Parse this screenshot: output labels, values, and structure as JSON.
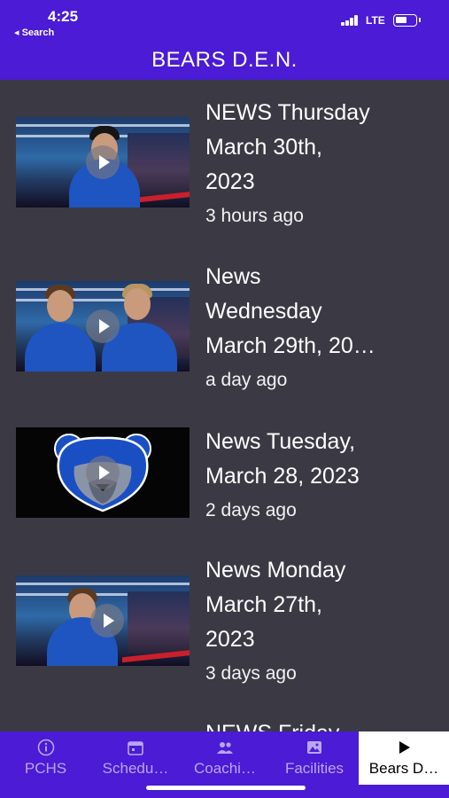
{
  "status": {
    "time": "4:25",
    "back_label": "◂ Search",
    "network": "LTE"
  },
  "header": {
    "title": "BEARS D.E.N."
  },
  "videos": [
    {
      "title": "NEWS Thursday March 30th, 2023",
      "title_lines": [
        "NEWS Thursday",
        "March 30th,",
        "2023"
      ],
      "age": "3 hours ago",
      "thumbnail": "news-desk-anchor"
    },
    {
      "title": "News Wednesday March 29th, 20…",
      "title_lines": [
        "News",
        "Wednesday",
        "March 29th, 20…"
      ],
      "age": "a day ago",
      "thumbnail": "news-desk-two-anchors"
    },
    {
      "title": "News Tuesday, March 28, 2023",
      "title_lines": [
        "News Tuesday,",
        "March 28, 2023"
      ],
      "age": "2 days ago",
      "thumbnail": "bear-logo"
    },
    {
      "title": "News Monday March 27th, 2023",
      "title_lines": [
        "News Monday",
        "March 27th,",
        "2023"
      ],
      "age": "3 days ago",
      "thumbnail": "news-desk-anchor"
    },
    {
      "title": "NEWS Friday",
      "title_lines": [
        "NEWS Friday"
      ],
      "age": "",
      "thumbnail": ""
    }
  ],
  "tabs": [
    {
      "label": "PCHS",
      "icon": "info-icon"
    },
    {
      "label": "Schedu…",
      "icon": "calendar-icon"
    },
    {
      "label": "Coachi…",
      "icon": "people-icon"
    },
    {
      "label": "Facilities",
      "icon": "image-icon"
    },
    {
      "label": "Bears D…",
      "icon": "play-icon",
      "active": true
    }
  ],
  "colors": {
    "brand": "#4b1bd6",
    "background": "#3b3a44",
    "tab_inactive": "#b8a6f2",
    "tab_active_bg": "#ffffff"
  }
}
